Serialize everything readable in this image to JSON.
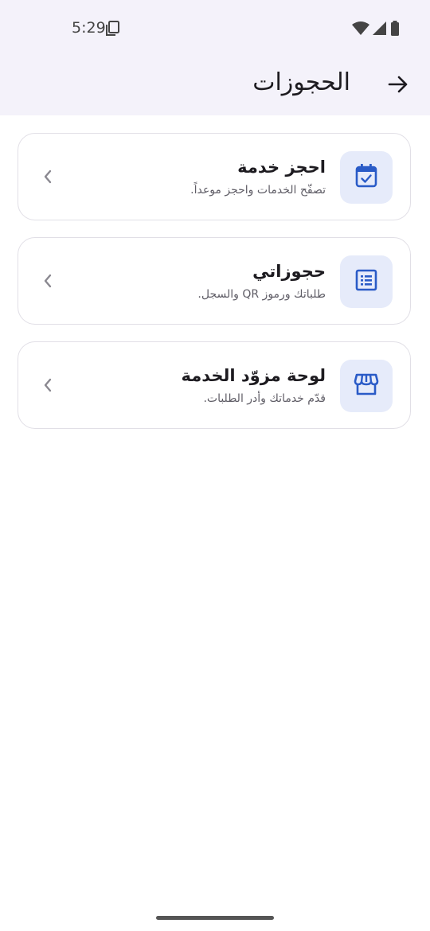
{
  "status_bar": {
    "time": "5:29"
  },
  "app_bar": {
    "title": "الحجوزات"
  },
  "cards": [
    {
      "title": "احجز خدمة",
      "subtitle": "تصفّح الخدمات واحجز موعداً.",
      "icon": "calendar-check-icon"
    },
    {
      "title": "حجوزاتي",
      "subtitle": "طلباتك ورموز QR والسجل.",
      "icon": "list-icon"
    },
    {
      "title": "لوحة مزوّد الخدمة",
      "subtitle": "قدّم خدماتك وأدر الطلبات.",
      "icon": "storefront-icon"
    }
  ],
  "colors": {
    "accent": "#2a5bc7",
    "icon_bg": "#e6ebfa",
    "appbar_bg": "#f4f2fa"
  }
}
